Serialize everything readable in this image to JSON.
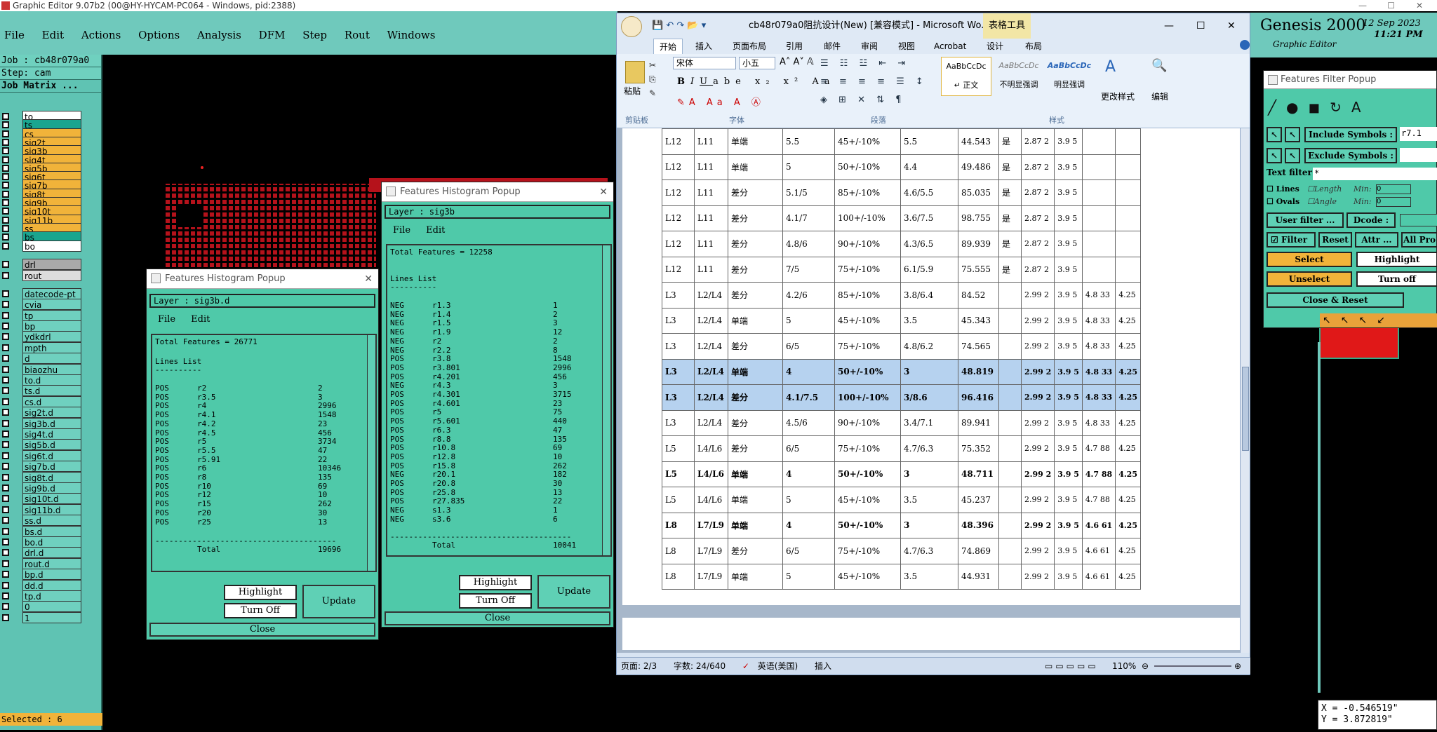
{
  "genesis": {
    "window_title": "Graphic Editor 9.07b2 (00@HY-HYCAM-PC064 - Windows, pid:2388)",
    "menu": [
      "File",
      "Edit",
      "Actions",
      "Options",
      "Analysis",
      "DFM",
      "Step",
      "Rout",
      "Windows"
    ],
    "job": "Job : cb48r079a0",
    "step": "Step: cam",
    "job_matrix": "Job Matrix ...",
    "layers": [
      "to",
      "ts",
      "cs",
      "sig2t",
      "sig3b",
      "sig4t",
      "sig5b",
      "sig6t",
      "sig7b",
      "sig8t",
      "sig9b",
      "sig10t",
      "sig11b",
      "ss",
      "bs",
      "bo",
      "drl",
      "rout",
      "datecode-pt",
      "cvia",
      "tp",
      "bp",
      "ydkdrl",
      "mpth",
      "d",
      "biaozhu",
      "to.d",
      "ts.d",
      "cs.d",
      "sig2t.d",
      "sig3b.d",
      "sig4t.d",
      "sig5b.d",
      "sig6t.d",
      "sig7b.d",
      "sig8t.d",
      "sig9b.d",
      "sig10t.d",
      "sig11b.d",
      "ss.d",
      "bs.d",
      "bo.d",
      "drl.d",
      "rout.d",
      "bp.d",
      "dd.d",
      "tp.d",
      "0",
      "1"
    ],
    "selected": "Selected : 6",
    "brand": "Genesis 2000",
    "brand_sub": "Graphic Editor",
    "date": "12 Sep 2023",
    "time": "11:21 PM",
    "coord_x": "X = -0.546519\"",
    "coord_y": "Y = 3.872819\""
  },
  "hist1": {
    "title": "Features Histogram Popup",
    "layer": "Layer :  sig3b.d",
    "menu_file": "File",
    "menu_edit": "Edit",
    "total": "Total Features = 26771",
    "list_title": "Lines List",
    "rows": [
      [
        "POS",
        "r2",
        "2"
      ],
      [
        "POS",
        "r3.5",
        "3"
      ],
      [
        "POS",
        "r4",
        "2996"
      ],
      [
        "POS",
        "r4.1",
        "1548"
      ],
      [
        "POS",
        "r4.2",
        "23"
      ],
      [
        "POS",
        "r4.5",
        "456"
      ],
      [
        "POS",
        "r5",
        "3734"
      ],
      [
        "POS",
        "r5.5",
        "47"
      ],
      [
        "POS",
        "r5.91",
        "22"
      ],
      [
        "POS",
        "r6",
        "10346"
      ],
      [
        "POS",
        "r8",
        "135"
      ],
      [
        "POS",
        "r10",
        "69"
      ],
      [
        "POS",
        "r12",
        "10"
      ],
      [
        "POS",
        "r15",
        "262"
      ],
      [
        "POS",
        "r20",
        "30"
      ],
      [
        "POS",
        "r25",
        "13"
      ]
    ],
    "total_label": "Total",
    "total_value": "19696",
    "highlight": "Highlight",
    "turn_off": "Turn Off",
    "update": "Update",
    "close": "Close"
  },
  "hist2": {
    "title": "Features Histogram Popup",
    "layer": "Layer :  sig3b",
    "menu_file": "File",
    "menu_edit": "Edit",
    "total": "Total Features = 12258",
    "list_title": "Lines List",
    "rows": [
      [
        "NEG",
        "r1.3",
        "1"
      ],
      [
        "NEG",
        "r1.4",
        "2"
      ],
      [
        "NEG",
        "r1.5",
        "3"
      ],
      [
        "NEG",
        "r1.9",
        "12"
      ],
      [
        "NEG",
        "r2",
        "2"
      ],
      [
        "NEG",
        "r2.2",
        "8"
      ],
      [
        "POS",
        "r3.8",
        "1548"
      ],
      [
        "POS",
        "r3.801",
        "2996"
      ],
      [
        "POS",
        "r4.201",
        "456"
      ],
      [
        "NEG",
        "r4.3",
        "3"
      ],
      [
        "POS",
        "r4.301",
        "3715"
      ],
      [
        "POS",
        "r4.601",
        "23"
      ],
      [
        "POS",
        "r5",
        "75"
      ],
      [
        "POS",
        "r5.601",
        "440"
      ],
      [
        "POS",
        "r6.3",
        "47"
      ],
      [
        "POS",
        "r8.8",
        "135"
      ],
      [
        "POS",
        "r10.8",
        "69"
      ],
      [
        "POS",
        "r12.8",
        "10"
      ],
      [
        "POS",
        "r15.8",
        "262"
      ],
      [
        "NEG",
        "r20.1",
        "182"
      ],
      [
        "POS",
        "r20.8",
        "30"
      ],
      [
        "POS",
        "r25.8",
        "13"
      ],
      [
        "POS",
        "r27.835",
        "22"
      ],
      [
        "NEG",
        "s1.3",
        "1"
      ],
      [
        "NEG",
        "s3.6",
        "6"
      ]
    ],
    "total_label": "Total",
    "total_value": "10041",
    "highlight": "Highlight",
    "turn_off": "Turn Off",
    "update": "Update",
    "close": "Close"
  },
  "word": {
    "title": "cb48r079a0阻抗设计(New) [兼容模式] - Microsoft Wo...",
    "context_tab": "表格工具",
    "tabs": [
      "开始",
      "插入",
      "页面布局",
      "引用",
      "邮件",
      "审阅",
      "视图",
      "Acrobat",
      "设计",
      "布局"
    ],
    "paste": "粘贴",
    "font_name": "宋体",
    "font_size": "小五",
    "styles": [
      {
        "preview": "AaBbCcDc",
        "name": "↵ 正文"
      },
      {
        "preview": "AaBbCcDc",
        "name": "不明显强调"
      },
      {
        "preview": "AaBbCcDc",
        "name": "明显强调"
      }
    ],
    "change_styles": "更改样式",
    "edit": "编辑",
    "group_labels": [
      "剪贴板",
      "字体",
      "段落",
      "样式"
    ],
    "table": [
      [
        "L12",
        "L11",
        "单端",
        "5.5",
        "45+/-10%",
        "5.5",
        "44.543",
        "是",
        "2.87 2",
        "3.9 5",
        "",
        ""
      ],
      [
        "L12",
        "L11",
        "单端",
        "5",
        "50+/-10%",
        "4.4",
        "49.486",
        "是",
        "2.87 2",
        "3.9 5",
        "",
        ""
      ],
      [
        "L12",
        "L11",
        "差分",
        "5.1/5",
        "85+/-10%",
        "4.6/5.5",
        "85.035",
        "是",
        "2.87 2",
        "3.9 5",
        "",
        ""
      ],
      [
        "L12",
        "L11",
        "差分",
        "4.1/7",
        "100+/-10%",
        "3.6/7.5",
        "98.755",
        "是",
        "2.87 2",
        "3.9 5",
        "",
        ""
      ],
      [
        "L12",
        "L11",
        "差分",
        "4.8/6",
        "90+/-10%",
        "4.3/6.5",
        "89.939",
        "是",
        "2.87 2",
        "3.9 5",
        "",
        ""
      ],
      [
        "L12",
        "L11",
        "差分",
        "7/5",
        "75+/-10%",
        "6.1/5.9",
        "75.555",
        "是",
        "2.87 2",
        "3.9 5",
        "",
        ""
      ],
      [
        "L3",
        "L2/L4",
        "差分",
        "4.2/6",
        "85+/-10%",
        "3.8/6.4",
        "84.52",
        "",
        "2.99 2",
        "3.9 5",
        "4.8 33",
        "4.25"
      ],
      [
        "L3",
        "L2/L4",
        "单端",
        "5",
        "45+/-10%",
        "3.5",
        "45.343",
        "",
        "2.99 2",
        "3.9 5",
        "4.8 33",
        "4.25"
      ],
      [
        "L3",
        "L2/L4",
        "差分",
        "6/5",
        "75+/-10%",
        "4.8/6.2",
        "74.565",
        "",
        "2.99 2",
        "3.9 5",
        "4.8 33",
        "4.25"
      ],
      [
        "L3",
        "L2/L4",
        "单端",
        "4",
        "50+/-10%",
        "3",
        "48.819",
        "",
        "2.99 2",
        "3.9 5",
        "4.8 33",
        "4.25"
      ],
      [
        "L3",
        "L2/L4",
        "差分",
        "4.1/7.5",
        "100+/-10%",
        "3/8.6",
        "96.416",
        "",
        "2.99 2",
        "3.9 5",
        "4.8 33",
        "4.25"
      ],
      [
        "L3",
        "L2/L4",
        "差分",
        "4.5/6",
        "90+/-10%",
        "3.4/7.1",
        "89.941",
        "",
        "2.99 2",
        "3.9 5",
        "4.8 33",
        "4.25"
      ],
      [
        "L5",
        "L4/L6",
        "差分",
        "6/5",
        "75+/-10%",
        "4.7/6.3",
        "75.352",
        "",
        "2.99 2",
        "3.9 5",
        "4.7 88",
        "4.25"
      ],
      [
        "L5",
        "L4/L6",
        "单端",
        "4",
        "50+/-10%",
        "3",
        "48.711",
        "",
        "2.99 2",
        "3.9 5",
        "4.7 88",
        "4.25"
      ],
      [
        "L5",
        "L4/L6",
        "单端",
        "5",
        "45+/-10%",
        "3.5",
        "45.237",
        "",
        "2.99 2",
        "3.9 5",
        "4.7 88",
        "4.25"
      ],
      [
        "L8",
        "L7/L9",
        "单端",
        "4",
        "50+/-10%",
        "3",
        "48.396",
        "",
        "2.99 2",
        "3.9 5",
        "4.6 61",
        "4.25"
      ],
      [
        "L8",
        "L7/L9",
        "差分",
        "6/5",
        "75+/-10%",
        "4.7/6.3",
        "74.869",
        "",
        "2.99 2",
        "3.9 5",
        "4.6 61",
        "4.25"
      ],
      [
        "L8",
        "L7/L9",
        "单端",
        "5",
        "45+/-10%",
        "3.5",
        "44.931",
        "",
        "2.99 2",
        "3.9 5",
        "4.6 61",
        "4.25"
      ]
    ],
    "status_page": "页面: 2/3",
    "status_words": "字数: 24/640",
    "status_lang": "英语(美国)",
    "status_insert": "插入",
    "zoom": "110%"
  },
  "filter": {
    "title": "Features Filter Popup",
    "include": "Include Symbols :",
    "include_val": "r7.1",
    "exclude": "Exclude Symbols :",
    "text_filter": "Text filter",
    "text_filter_val": "*",
    "lines": "Lines",
    "ovals": "Ovals",
    "length": "Length",
    "angle": "Angle",
    "min": "Min:",
    "min_val": "0",
    "user_filter": "User filter ...",
    "dcode": "Dcode :",
    "filter": "Filter",
    "reset": "Reset",
    "attr": "Attr ...",
    "all_pro": "All Pro",
    "select": "Select",
    "unselect": "Unselect",
    "highlight": "Highlight",
    "turn_off": "Turn off",
    "close_reset": "Close & Reset"
  }
}
